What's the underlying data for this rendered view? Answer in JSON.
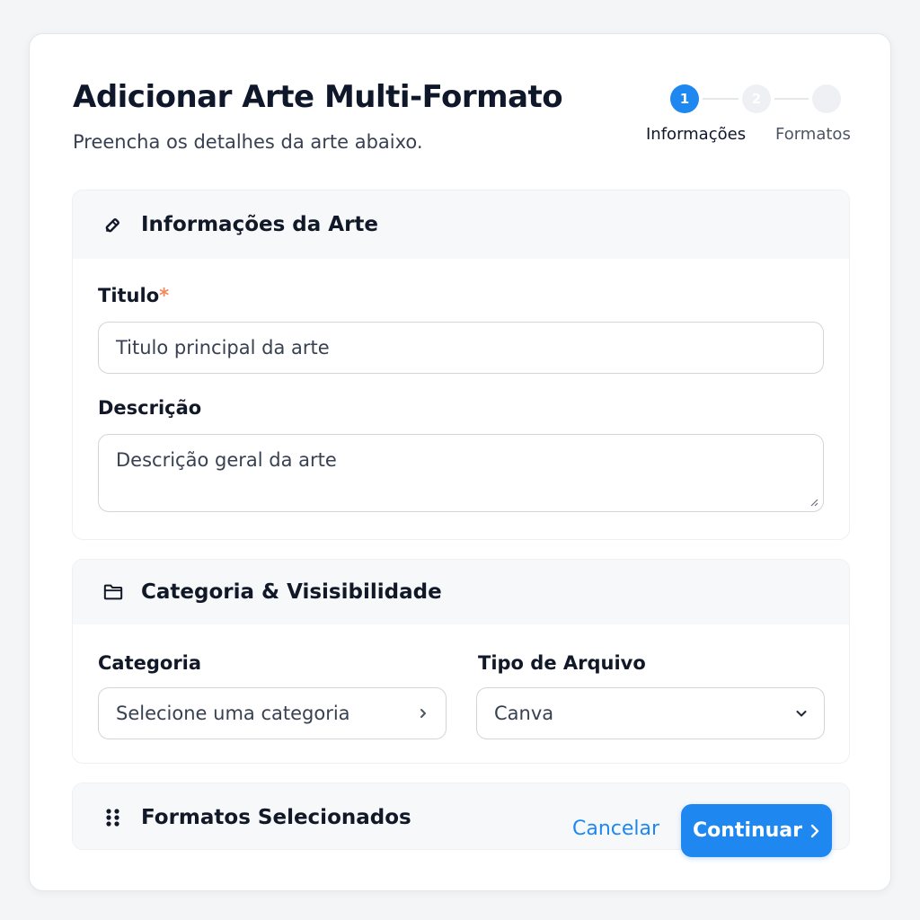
{
  "header": {
    "title": "Adicionar Arte Multi-Formato",
    "subtitle": "Preencha os detalhes da arte abaixo."
  },
  "stepper": {
    "steps": [
      {
        "number": "1",
        "label": "Informações",
        "state": "active"
      },
      {
        "number": "2",
        "label": "",
        "state": "pending"
      },
      {
        "number": "",
        "label": "Formatos",
        "state": "pending"
      }
    ]
  },
  "sections": {
    "info": {
      "title": "Informações da Arte",
      "icon": "pencil-icon",
      "title_field": {
        "label": "Titulo",
        "required_mark": "*",
        "placeholder": "Titulo principal da arte"
      },
      "description_field": {
        "label": "Descrição",
        "placeholder": "Descrição geral da arte"
      }
    },
    "category": {
      "title": "Categoria & Visisibilidade",
      "icon": "folder-icon",
      "category_field": {
        "label": "Categoria",
        "value": "Selecione uma categoria"
      },
      "file_type_field": {
        "label": "Tipo de Arquivo",
        "value": "Canva"
      }
    },
    "formats": {
      "title": "Formatos Selecionados",
      "icon": "grid-dots-icon"
    }
  },
  "footer": {
    "cancel_label": "Cancelar",
    "continue_label": "Continuar"
  },
  "colors": {
    "accent": "#1e88f0",
    "required": "#f08a5d",
    "text": "#111827",
    "section_header_bg": "#f7f8fa"
  }
}
